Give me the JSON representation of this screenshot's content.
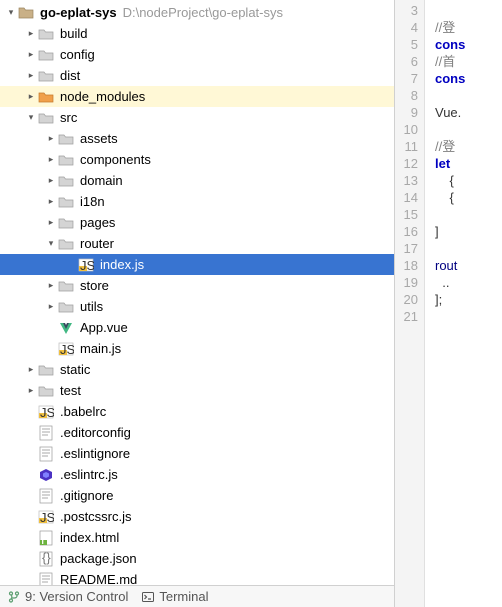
{
  "project": {
    "name": "go-eplat-sys",
    "path": "D:\\nodeProject\\go-eplat-sys"
  },
  "tree": [
    {
      "depth": 0,
      "arrow": "down",
      "icon": "folder-root",
      "label": "go-eplat-sys",
      "bold": true,
      "hint": "D:\\nodeProject\\go-eplat-sys"
    },
    {
      "depth": 1,
      "arrow": "right",
      "icon": "folder",
      "label": "build"
    },
    {
      "depth": 1,
      "arrow": "right",
      "icon": "folder",
      "label": "config"
    },
    {
      "depth": 1,
      "arrow": "right",
      "icon": "folder",
      "label": "dist"
    },
    {
      "depth": 1,
      "arrow": "right",
      "icon": "folder-orange",
      "label": "node_modules",
      "highlight": true
    },
    {
      "depth": 1,
      "arrow": "down",
      "icon": "folder",
      "label": "src"
    },
    {
      "depth": 2,
      "arrow": "right",
      "icon": "folder",
      "label": "assets"
    },
    {
      "depth": 2,
      "arrow": "right",
      "icon": "folder",
      "label": "components"
    },
    {
      "depth": 2,
      "arrow": "right",
      "icon": "folder",
      "label": "domain"
    },
    {
      "depth": 2,
      "arrow": "right",
      "icon": "folder",
      "label": "i18n"
    },
    {
      "depth": 2,
      "arrow": "right",
      "icon": "folder",
      "label": "pages"
    },
    {
      "depth": 2,
      "arrow": "down",
      "icon": "folder",
      "label": "router"
    },
    {
      "depth": 3,
      "arrow": "none",
      "icon": "js",
      "label": "index.js",
      "selected": true
    },
    {
      "depth": 2,
      "arrow": "right",
      "icon": "folder",
      "label": "store"
    },
    {
      "depth": 2,
      "arrow": "right",
      "icon": "folder",
      "label": "utils"
    },
    {
      "depth": 2,
      "arrow": "none",
      "icon": "vue",
      "label": "App.vue"
    },
    {
      "depth": 2,
      "arrow": "none",
      "icon": "js",
      "label": "main.js"
    },
    {
      "depth": 1,
      "arrow": "right",
      "icon": "folder",
      "label": "static"
    },
    {
      "depth": 1,
      "arrow": "right",
      "icon": "folder",
      "label": "test"
    },
    {
      "depth": 1,
      "arrow": "none",
      "icon": "js",
      "label": ".babelrc"
    },
    {
      "depth": 1,
      "arrow": "none",
      "icon": "text",
      "label": ".editorconfig"
    },
    {
      "depth": 1,
      "arrow": "none",
      "icon": "text",
      "label": ".eslintignore"
    },
    {
      "depth": 1,
      "arrow": "none",
      "icon": "eslint",
      "label": ".eslintrc.js"
    },
    {
      "depth": 1,
      "arrow": "none",
      "icon": "text",
      "label": ".gitignore"
    },
    {
      "depth": 1,
      "arrow": "none",
      "icon": "js",
      "label": ".postcssrc.js"
    },
    {
      "depth": 1,
      "arrow": "none",
      "icon": "html",
      "label": "index.html"
    },
    {
      "depth": 1,
      "arrow": "none",
      "icon": "json",
      "label": "package.json"
    },
    {
      "depth": 1,
      "arrow": "none",
      "icon": "text",
      "label": "README.md"
    }
  ],
  "bottom": {
    "vcs": "9: Version Control",
    "terminal": "Terminal"
  },
  "gutter_start": 3,
  "gutter_end": 21,
  "code_lines": [
    "",
    {
      "cls": "cm",
      "t": "//登"
    },
    {
      "cls": "kw",
      "t": "cons"
    },
    {
      "cls": "cm",
      "t": "//首"
    },
    {
      "cls": "kw",
      "t": "cons"
    },
    "",
    "Vue.",
    "",
    {
      "cls": "cm",
      "t": "//登"
    },
    {
      "cls": "kw",
      "t": "let "
    },
    "    {",
    "    {",
    "",
    "]",
    "",
    {
      "cls": "kw2",
      "t": "rout"
    },
    "  ..",
    "];",
    ""
  ]
}
